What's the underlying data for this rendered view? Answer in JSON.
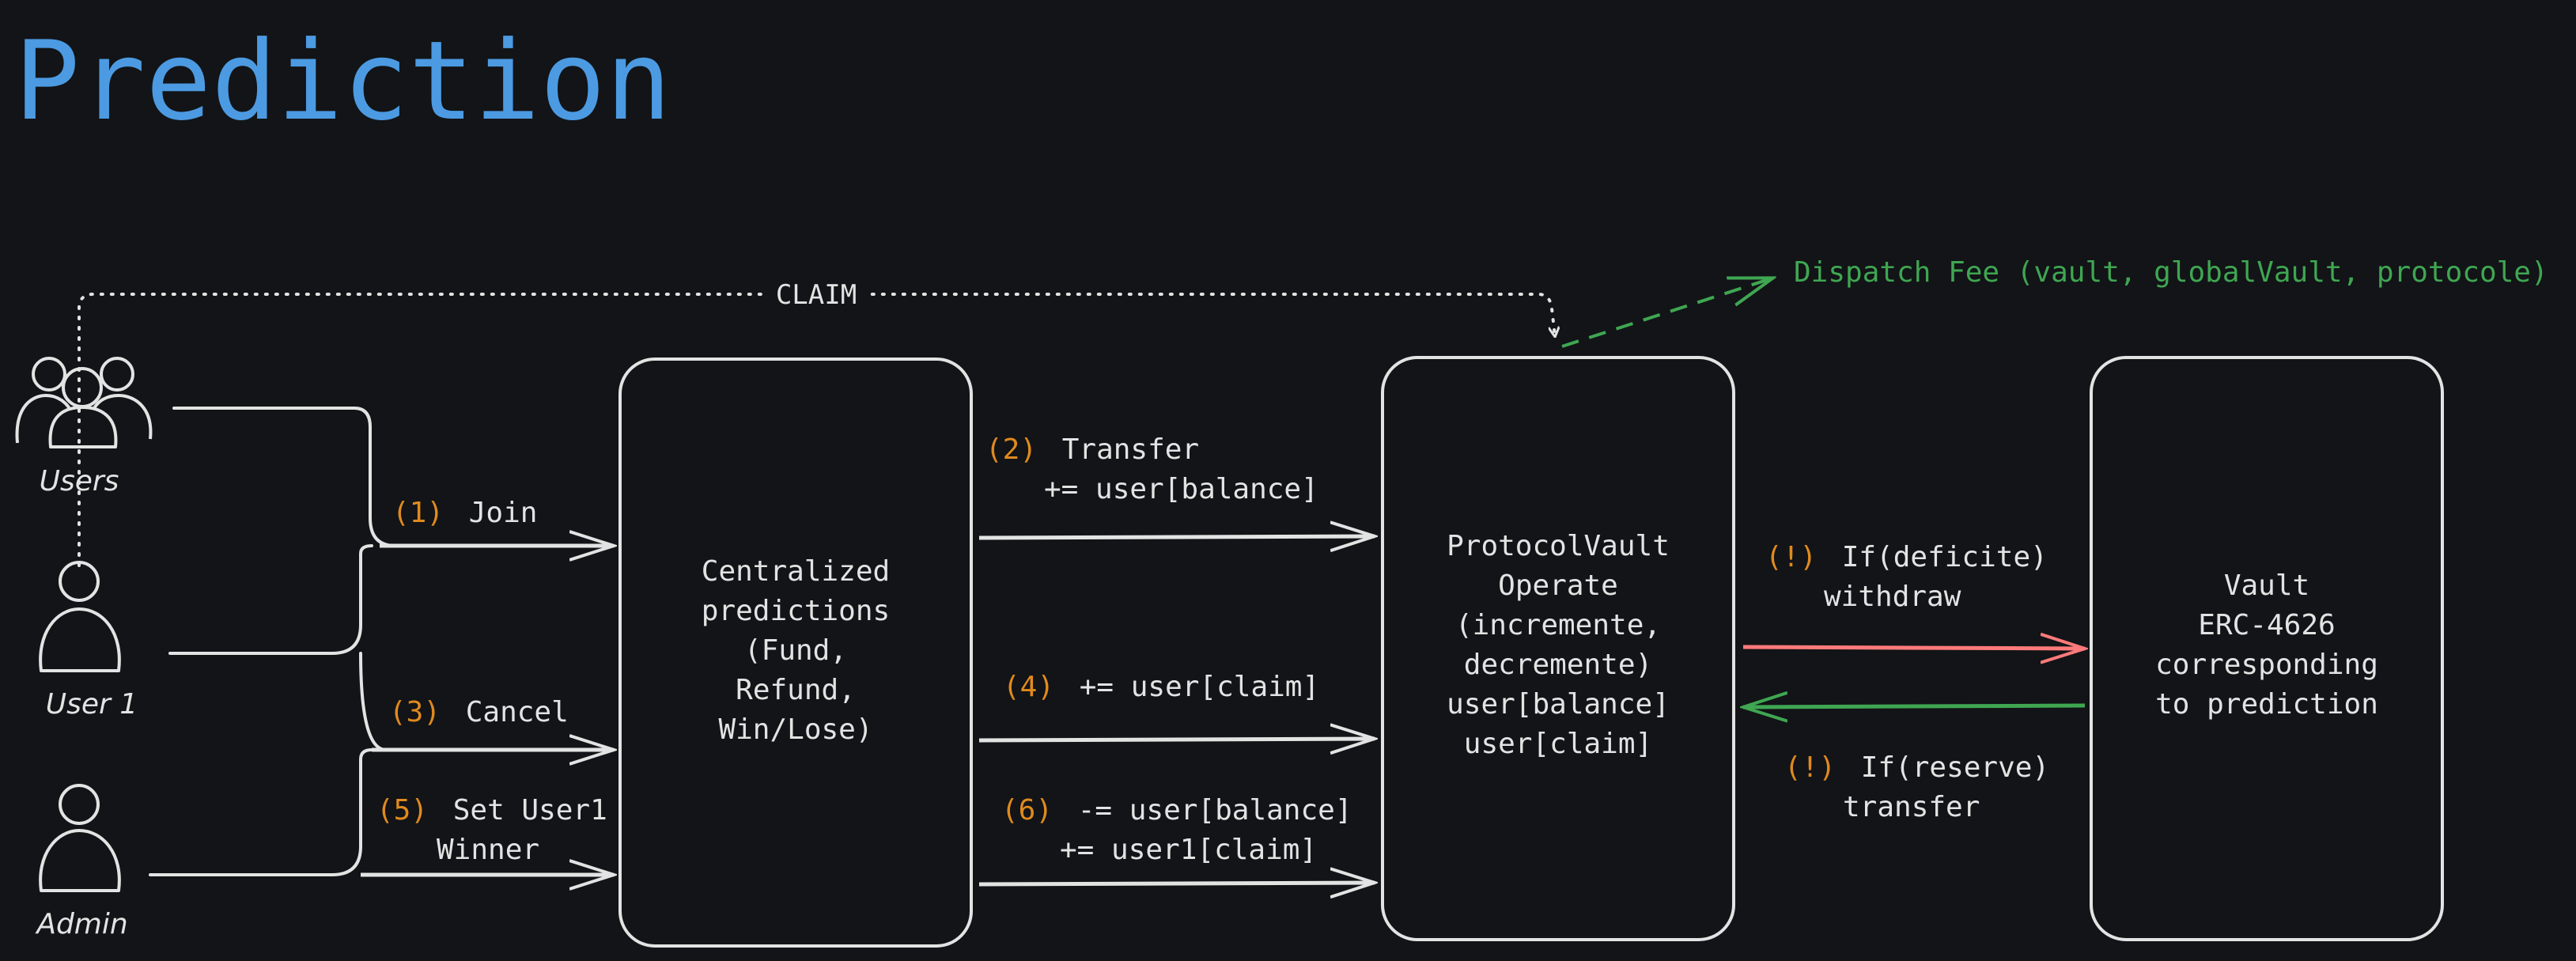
{
  "title": "Prediction",
  "colors": {
    "background": "#121417",
    "title": "#4c9ae2",
    "stroke": "#e3e3e3",
    "step": "#e08a1e",
    "fee": "#3fa652",
    "withdraw_arrow": "#ff7a7a",
    "transfer_arrow": "#3fa652"
  },
  "actors": {
    "users": "Users",
    "user1": "User 1",
    "admin": "Admin"
  },
  "claim_label": "CLAIM",
  "fee_label": "Dispatch Fee (vault, globalVault, protocole)",
  "boxes": {
    "centralized": [
      "Centralized",
      "predictions",
      "(Fund,",
      "Refund,",
      "Win/Lose)"
    ],
    "protocol_vault": [
      "ProtocolVault",
      "Operate",
      "(incremente,",
      "decremente)",
      "user[balance]",
      "user[claim]"
    ],
    "vault": [
      "Vault",
      "ERC-4626",
      "corresponding",
      "to prediction"
    ]
  },
  "steps": {
    "join": {
      "num": "(1)",
      "text": "Join"
    },
    "transfer": {
      "num": "(2)",
      "line1": "Transfer",
      "line2": "+= user[balance]"
    },
    "cancel": {
      "num": "(3)",
      "text": "Cancel"
    },
    "claim4": {
      "num": "(4)",
      "text": "+= user[claim]"
    },
    "winner": {
      "num": "(5)",
      "line1": "Set User1",
      "line2": "Winner"
    },
    "step6": {
      "num": "(6)",
      "line1": "-= user[balance]",
      "line2": "+= user1[claim]"
    },
    "deficit": {
      "num": "(!)",
      "line1": "If(deficite)",
      "line2": "withdraw"
    },
    "reserve": {
      "num": "(!)",
      "line1": "If(reserve)",
      "line2": "transfer"
    }
  },
  "icons": [
    "users-group-icon",
    "user-icon",
    "admin-icon"
  ]
}
